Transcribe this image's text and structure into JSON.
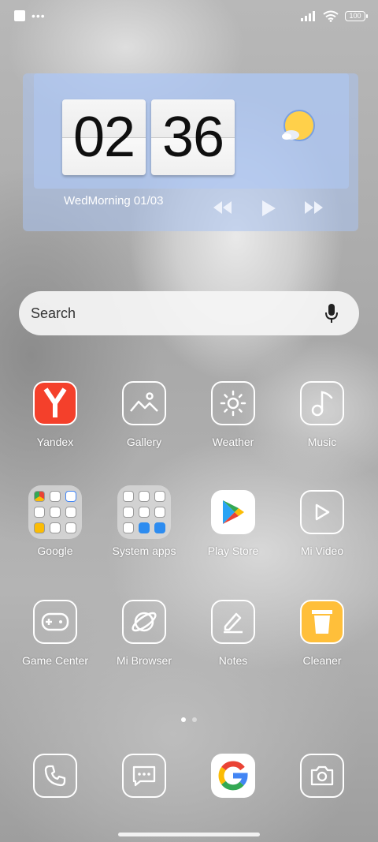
{
  "status_bar": {
    "battery": "100"
  },
  "widget": {
    "hour": "02",
    "minute": "36",
    "date_text": "WedMorning 01/03"
  },
  "search": {
    "placeholder": "Search"
  },
  "apps": {
    "yandex": "Yandex",
    "gallery": "Gallery",
    "weather": "Weather",
    "music": "Music",
    "google": "Google",
    "system_apps": "System apps",
    "play_store": "Play Store",
    "mi_video": "Mi Video",
    "game_center": "Game Center",
    "mi_browser": "Mi Browser",
    "notes": "Notes",
    "cleaner": "Cleaner"
  },
  "dock": {
    "icons": [
      "phone-icon",
      "messages-icon",
      "google-icon",
      "camera-icon"
    ]
  },
  "colors": {
    "yandex_red": "#f4402b",
    "cleaner_yellow": "#ffbf3a",
    "widget_blue": "#aac3f0"
  }
}
